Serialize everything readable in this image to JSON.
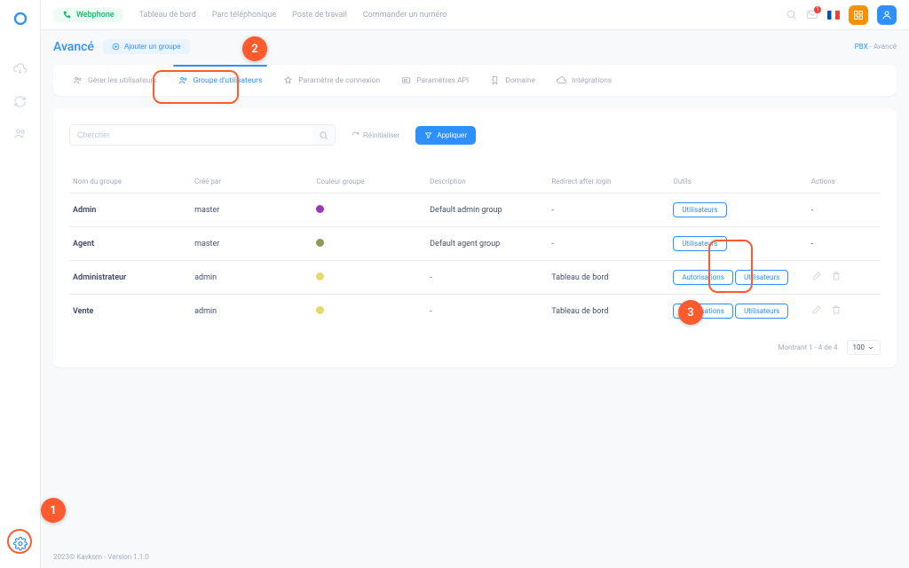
{
  "topnav": {
    "webphone": "Webphone",
    "links": [
      "Tableau de bord",
      "Parc téléphonique",
      "Poste de travail",
      "Commander un numéro"
    ],
    "notif_count": "1"
  },
  "page": {
    "title": "Avancé",
    "add_group": "Ajouter un groupe"
  },
  "breadcrumb": {
    "root": "PBX",
    "sep": "-",
    "current": "Avancé"
  },
  "tabs": [
    {
      "label": "Gérer les utilisateurs",
      "icon": "users-icon"
    },
    {
      "label": "Groupe d'utilisateurs",
      "icon": "users-icon",
      "active": true
    },
    {
      "label": "Paramètre de connexion",
      "icon": "star-icon"
    },
    {
      "label": "Paramètres API",
      "icon": "api-icon"
    },
    {
      "label": "Domaine",
      "icon": "bookmark-icon"
    },
    {
      "label": "Intégrations",
      "icon": "cloud-icon"
    }
  ],
  "toolbar": {
    "search_placeholder": "Chercher",
    "reset": "Réinitialiser",
    "apply": "Appliquer"
  },
  "columns": {
    "name": "Nom du groupe",
    "created_by": "Créé par",
    "color": "Couleur groupe",
    "description": "Description",
    "redirect": "Redirect after login",
    "tools": "Outils",
    "actions": "Actions"
  },
  "rows": [
    {
      "name": "Admin",
      "created_by": "master",
      "color": "#9a3ab4",
      "description": "Default admin group",
      "redirect": "-",
      "tools": [
        "Utilisateurs"
      ],
      "editable": false
    },
    {
      "name": "Agent",
      "created_by": "master",
      "color": "#8d9a5b",
      "description": "Default agent group",
      "redirect": "-",
      "tools": [
        "Utilisateurs"
      ],
      "editable": false
    },
    {
      "name": "Administrateur",
      "created_by": "admin",
      "color": "#e6d96a",
      "description": "-",
      "redirect": "Tableau de bord",
      "tools": [
        "Autorisations",
        "Utilisateurs"
      ],
      "editable": true
    },
    {
      "name": "Vente",
      "created_by": "admin",
      "color": "#e6d96a",
      "description": "-",
      "redirect": "Tableau de bord",
      "tools": [
        "Autorisations",
        "Utilisateurs"
      ],
      "editable": true
    }
  ],
  "footer": {
    "showing": "Montrant 1 - 4 de 4",
    "pagesize": "100"
  },
  "copyright": "2023© Kavkom - Version 1.1.0",
  "markers": {
    "m1": "1",
    "m2": "2",
    "m3": "3"
  }
}
